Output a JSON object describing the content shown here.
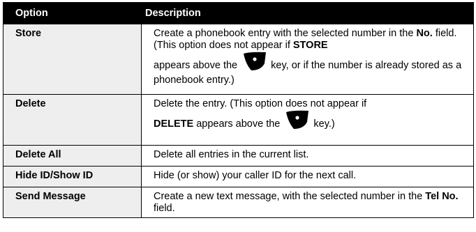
{
  "headers": {
    "option": "Option",
    "description": "Description"
  },
  "rows": [
    {
      "option": "Store",
      "desc": {
        "t1": "Create a phonebook entry with the selected number in the ",
        "b1": "No.",
        "t2": " field. (This option does not appear if ",
        "b2": "STORE",
        "t3": "appears above the ",
        "t4": " key, or if the number is already stored as a phonebook entry.)"
      }
    },
    {
      "option": "Delete",
      "desc": {
        "t1": "Delete the entry. (This option does not appear if ",
        "b1": "DELETE",
        "t2": " appears above the ",
        "t3": " key.)"
      }
    },
    {
      "option": "Delete All",
      "desc": {
        "t1": "Delete all entries in the current list."
      }
    },
    {
      "option": "Hide ID/Show ID",
      "desc": {
        "t1": "Hide (or show) your caller ID for the next call."
      }
    },
    {
      "option": "Send Message",
      "desc": {
        "t1": "Create a new text message, with the selected number in the ",
        "b1": "Tel No.",
        "t2": " field."
      }
    }
  ],
  "icons": {
    "softkey": "right-softkey-icon"
  },
  "colors": {
    "header_bg": "#000000",
    "header_text": "#ffffff",
    "option_bg": "#eeeeee"
  }
}
